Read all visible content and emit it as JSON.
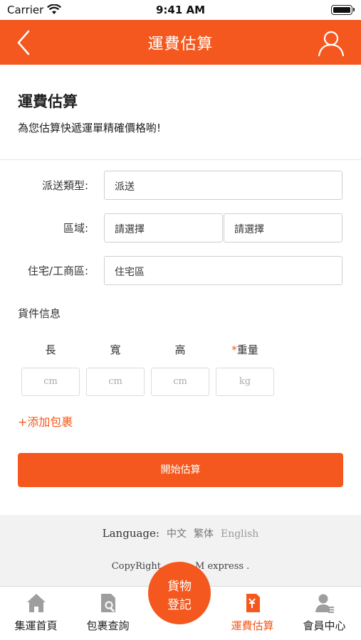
{
  "status_bar": {
    "carrier": "Carrier",
    "time": "9:41 AM"
  },
  "nav": {
    "title": "運費估算",
    "back_icon": "chevron-left-icon",
    "user_icon": "user-icon"
  },
  "intro": {
    "title": "運費估算",
    "subtitle": "為您估算快遞運單精確價格喲!"
  },
  "form": {
    "delivery_type": {
      "label": "派送類型:",
      "value": "派送"
    },
    "region": {
      "label": "區域:",
      "value_1": "請選擇",
      "value_2": "請選擇"
    },
    "residential": {
      "label": "住宅/工商區:",
      "value": "住宅區"
    }
  },
  "goods": {
    "title": "貨件信息",
    "dimensions": [
      {
        "label": "長",
        "placeholder": "cm"
      },
      {
        "label": "寬",
        "placeholder": "cm"
      },
      {
        "label": "高",
        "placeholder": "cm"
      },
      {
        "label": "重量",
        "required_mark": "*",
        "placeholder": "kg"
      }
    ],
    "add_package": "+添加包裹"
  },
  "calculate_button": "開始估算",
  "footer": {
    "language_label": "Language:",
    "languages": [
      "中文",
      "繁体",
      "English"
    ],
    "copyright_left": "CopyRight",
    "copyright_right": "M express ."
  },
  "tabs": [
    {
      "label": "集運首頁",
      "icon": "home-icon"
    },
    {
      "label": "包裹查詢",
      "icon": "search-document-icon"
    },
    {
      "label": "運費估算",
      "icon": "calculator-icon",
      "active": true
    },
    {
      "label": "會員中心",
      "icon": "member-icon"
    }
  ],
  "fab": {
    "line1": "貨物",
    "line2": "登記"
  },
  "colors": {
    "accent": "#f4581e",
    "footer_bg": "#f2f2f2"
  }
}
